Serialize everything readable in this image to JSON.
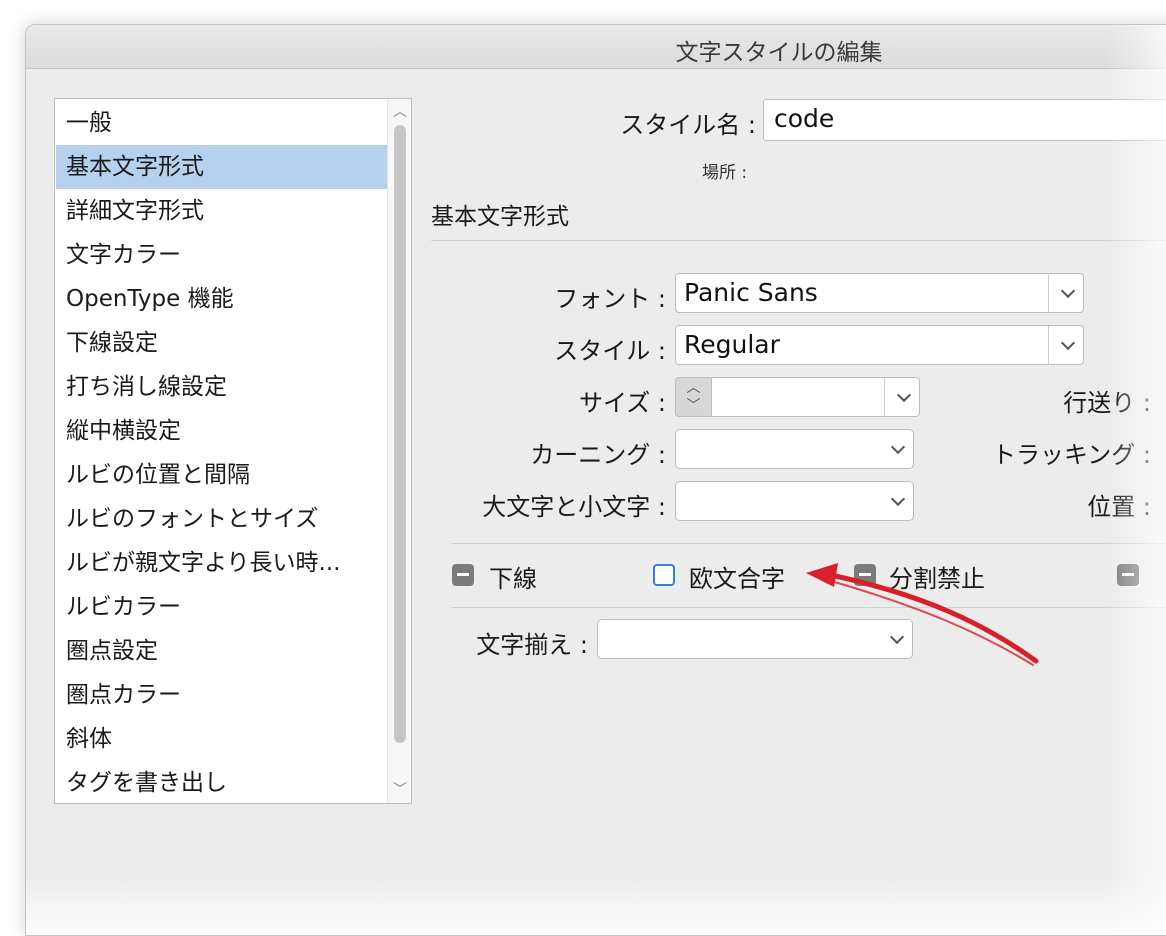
{
  "window": {
    "title": "文字スタイルの編集"
  },
  "sidebar": {
    "items": [
      {
        "label": "一般"
      },
      {
        "label": "基本文字形式",
        "selected": true
      },
      {
        "label": "詳細文字形式"
      },
      {
        "label": "文字カラー"
      },
      {
        "label": "OpenType 機能"
      },
      {
        "label": "下線設定"
      },
      {
        "label": "打ち消し線設定"
      },
      {
        "label": "縦中横設定"
      },
      {
        "label": "ルビの位置と間隔"
      },
      {
        "label": "ルビのフォントとサイズ"
      },
      {
        "label": "ルビが親文字より長い時..."
      },
      {
        "label": "ルビカラー"
      },
      {
        "label": "圏点設定"
      },
      {
        "label": "圏点カラー"
      },
      {
        "label": "斜体"
      },
      {
        "label": "タグを書き出し"
      }
    ]
  },
  "form": {
    "style_name_label": "スタイル名 :",
    "style_name_value": "code",
    "location_label": "場所 :",
    "section_title": "基本文字形式",
    "font_label": "フォント :",
    "font_value": "Panic Sans",
    "style_label": "スタイル :",
    "style_value": "Regular",
    "size_label": "サイズ :",
    "size_value": "",
    "leading_label": "行送り :",
    "kerning_label": "カーニング :",
    "kerning_value": "",
    "tracking_label": "トラッキング :",
    "case_label": "大文字と小文字 :",
    "case_value": "",
    "position_label": "位置 :",
    "align_label": "文字揃え :",
    "align_value": ""
  },
  "checkboxes": [
    {
      "label": "下線",
      "state": "mixed"
    },
    {
      "label": "欧文合字",
      "state": "unchecked"
    },
    {
      "label": "分割禁止",
      "state": "mixed"
    },
    {
      "label": "",
      "state": "mixed"
    }
  ],
  "annotation": {
    "arrow_color": "#d8202a"
  }
}
